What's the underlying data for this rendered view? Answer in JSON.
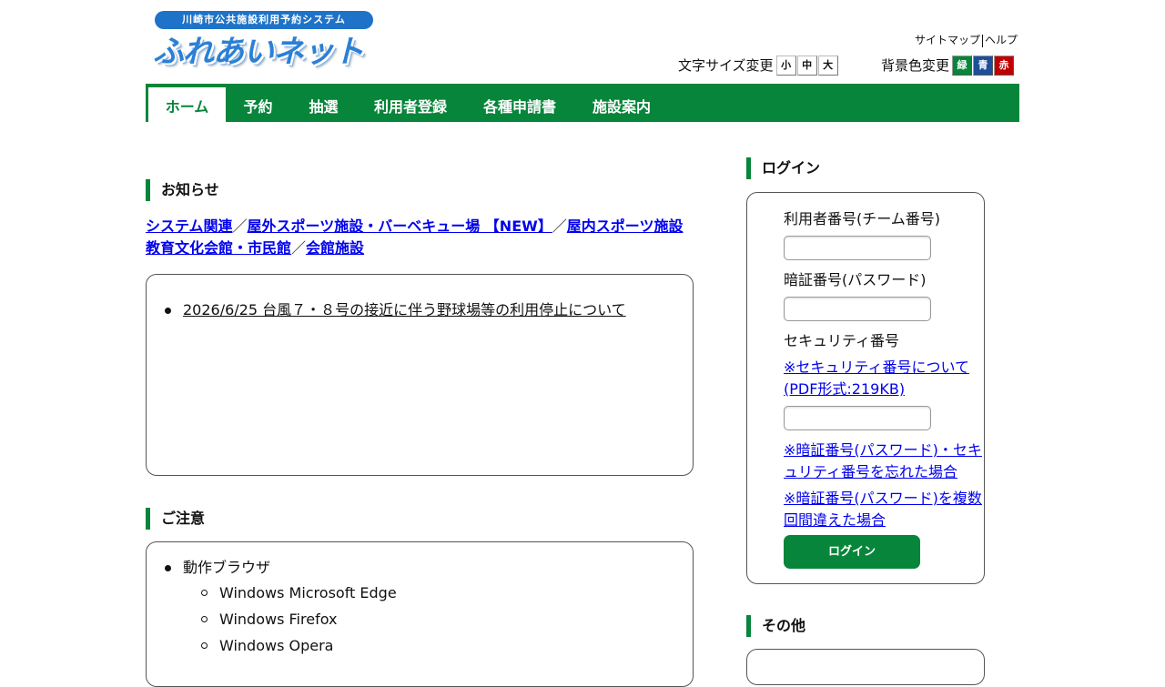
{
  "header": {
    "logo_subtitle": "川崎市公共施設利用予約システム",
    "logo_title": "ふれあいネット",
    "sitemap": "サイトマップ",
    "help": "ヘルプ",
    "font_size_label": "文字サイズ変更",
    "font_sizes": [
      "小",
      "中",
      "大"
    ],
    "bg_color_label": "背景色変更",
    "bg_colors": [
      {
        "label": "緑",
        "color": "#07853a"
      },
      {
        "label": "青",
        "color": "#1d4f9a"
      },
      {
        "label": "赤",
        "color": "#c00000"
      }
    ]
  },
  "nav": {
    "items": [
      "ホーム",
      "予約",
      "抽選",
      "利用者登録",
      "各種申請書",
      "施設案内"
    ],
    "active": "ホーム",
    "color": "#07853a"
  },
  "news": {
    "heading": "お知らせ",
    "categories": [
      "システム関連",
      "屋外スポーツ施設・バーベキュー場 【NEW】",
      "屋内スポーツ施設",
      "教育文化会館・市民館",
      "会館施設"
    ],
    "separator": "／",
    "items": [
      "2026/6/25 台風７・８号の接近に伴う野球場等の利用停止について"
    ]
  },
  "caution": {
    "heading": "ご注意",
    "browser_label": "動作ブラウザ",
    "browsers": [
      "Windows Microsoft Edge",
      "Windows Firefox",
      "Windows Opera"
    ]
  },
  "login": {
    "heading": "ログイン",
    "user_number_label": "利用者番号(チーム番号)",
    "user_number_value": "",
    "password_label": "暗証番号(パスワード)",
    "password_value": "",
    "security_label": "セキュリティ番号",
    "security_link": "※セキュリティ番号について(PDF形式:219KB)",
    "security_value": "",
    "forgot_link": "※暗証番号(パスワード)・セキュリティ番号を忘れた場合",
    "mistake_link": "※暗証番号(パスワード)を複数回間違えた場合",
    "button": "ログイン"
  },
  "other": {
    "heading": "その他"
  }
}
